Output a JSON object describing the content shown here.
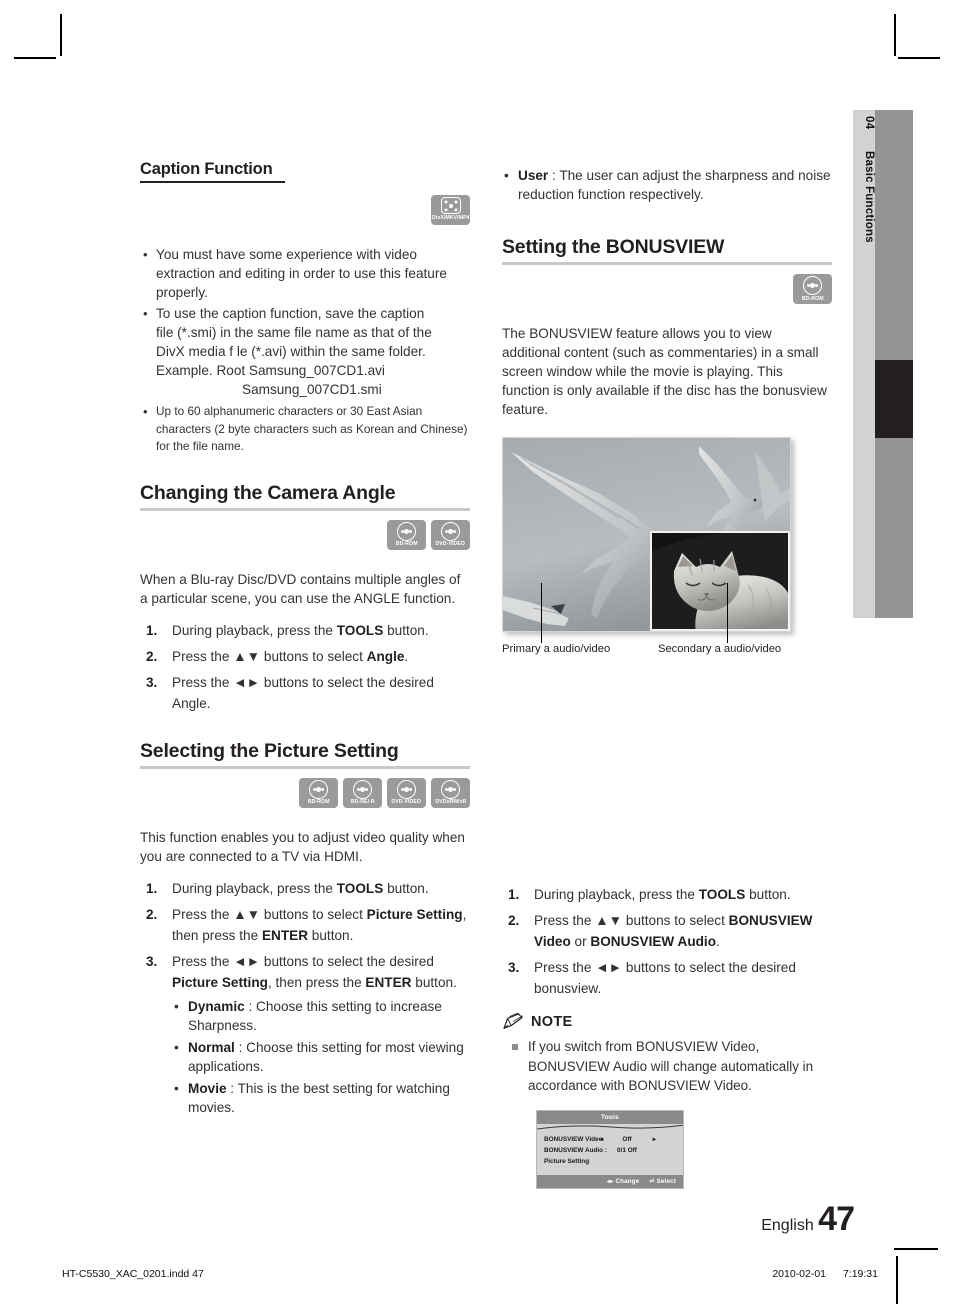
{
  "chapter_tab": {
    "number": "04",
    "title": "Basic Functions"
  },
  "left_column": {
    "caption_function": {
      "heading": "Caption Function",
      "icons": [
        {
          "name": "divx-mkv-mp4-icon",
          "label": "DivX/MKV/MP4"
        }
      ],
      "bullets": [
        "You must have some experience with video extraction and editing in order to use this feature properly.",
        "To use the caption function, save the caption file (*.smi) in the same file name as that of the DivX media f le (*.avi) within the same folder. Example. Root Samsung_007CD1.avi Samsung_007CD1.smi",
        "Up to 60 alphanumeric characters or 30 East Asian characters (2 byte characters such as Korean and Chinese) for the file name."
      ],
      "bullet2_line1": "To use the caption function, save the caption",
      "bullet2_line2": "file (*.smi) in the same file name as that of the",
      "bullet2_line3": "DivX media f le (*.avi) within the same folder.",
      "bullet2_line4": "Example. Root Samsung_007CD1.avi",
      "bullet2_line5": "Samsung_007CD1.smi"
    },
    "camera_angle": {
      "heading": "Changing the Camera Angle",
      "icons": [
        {
          "name": "bd-rom-icon",
          "label": "BD-ROM"
        },
        {
          "name": "dvd-video-icon",
          "label": "DVD-VIDEO"
        }
      ],
      "intro": "When a Blu-ray Disc/DVD contains multiple angles of a particular scene, you can use the ANGLE function.",
      "steps": [
        {
          "num": "1.",
          "pre": "During playback, press the ",
          "bold": "TOOLS",
          "post": " button."
        },
        {
          "num": "2.",
          "pre": "Press the ▲▼ buttons to select ",
          "bold": "Angle",
          "post": "."
        },
        {
          "num": "3.",
          "pre": "Press the ◄► buttons to select the desired Angle.",
          "bold": "",
          "post": ""
        }
      ]
    },
    "picture_setting": {
      "heading": "Selecting the Picture Setting",
      "icons": [
        {
          "name": "bd-rom-icon",
          "label": "BD-ROM"
        },
        {
          "name": "bd-re-r-icon",
          "label": "BD-RE/-R"
        },
        {
          "name": "dvd-video-icon",
          "label": "DVD-VIDEO"
        },
        {
          "name": "dvd-rw-r-icon",
          "label": "DVD±RW/±R"
        }
      ],
      "intro": "This function enables you to adjust video quality when you are connected to a TV via HDMI.",
      "step1_pre": "During playback, press the ",
      "step1_bold": "TOOLS",
      "step1_post": " button.",
      "step2_pre": "Press the ▲▼ buttons to select ",
      "step2_bold1": "Picture Setting",
      "step2_mid": ", then press the ",
      "step2_bold2": "ENTER",
      "step2_post": " button.",
      "step3_pre": "Press the ◄► buttons to select the desired ",
      "step3_bold1": "Picture Setting",
      "step3_mid": ", then press the ",
      "step3_bold2": "ENTER",
      "step3_post": " button.",
      "options": [
        {
          "term": "Dynamic",
          "desc": " : Choose this setting to increase Sharpness."
        },
        {
          "term": "Normal",
          "desc": " : Choose this setting for most viewing applications."
        },
        {
          "term": "Movie",
          "desc": " : This is the best setting for watching movies."
        }
      ]
    }
  },
  "right_column": {
    "user_option": {
      "term": "User",
      "desc": " : The user can adjust the sharpness and noise reduction function respectively."
    },
    "bonusview": {
      "heading": "Setting the BONUSVIEW",
      "icons": [
        {
          "name": "bd-rom-icon",
          "label": "BD-ROM"
        }
      ],
      "intro": "The BONUSVIEW feature allows you to view additional content (such as commentaries) in a small screen window while the movie is playing. This function is only available if the disc has the bonusview feature.",
      "figure": {
        "primary_caption": "Primary a audio/video",
        "secondary_caption": "Secondary a audio/video"
      },
      "step1_pre": "During playback, press the ",
      "step1_bold": "TOOLS",
      "step1_post": " button.",
      "step2_pre": "Press the ▲▼ buttons to select ",
      "step2_bold1": "BONUSVIEW Video",
      "step2_mid": " or ",
      "step2_bold2": "BONUSVIEW Audio",
      "step2_post": ".",
      "step3": "Press the ◄► buttons to select the desired bonusview.",
      "step_nums": {
        "one": "1.",
        "two": "2.",
        "three": "3."
      }
    },
    "note": {
      "title": "NOTE",
      "items": [
        "If you switch from BONUSVIEW Video, BONUSVIEW Audio will change automatically in accordance with BONUSVIEW Video."
      ]
    },
    "osd": {
      "title": "Tools",
      "rows": [
        {
          "label": "BONUSVIEW Video",
          "left_arrow": "◂",
          "value": "Off",
          "right_arrow": "▸"
        },
        {
          "label": "BONUSVIEW Audio :",
          "left_arrow": "",
          "value": "0/1 Off",
          "right_arrow": ""
        },
        {
          "label": "Picture Setting",
          "left_arrow": "",
          "value": "",
          "right_arrow": ""
        }
      ],
      "footer_change": "◂▸ Change",
      "footer_select": "⏎ Select"
    }
  },
  "page_footer": {
    "language": "English",
    "page_number": "47",
    "file_name": "HT-C5530_XAC_0201.indd   47",
    "date": "2010-02-01",
    "time": "7:19:31"
  },
  "colors": {
    "icon_grey": "#9a9a9a",
    "tab_light": "#d2d2d2",
    "tab_mid": "#949494",
    "tab_active": "#231f20",
    "rule_grey": "#c9c9c9",
    "osd_bg": "#d3d3d3",
    "osd_bar": "#8a8a8a"
  }
}
